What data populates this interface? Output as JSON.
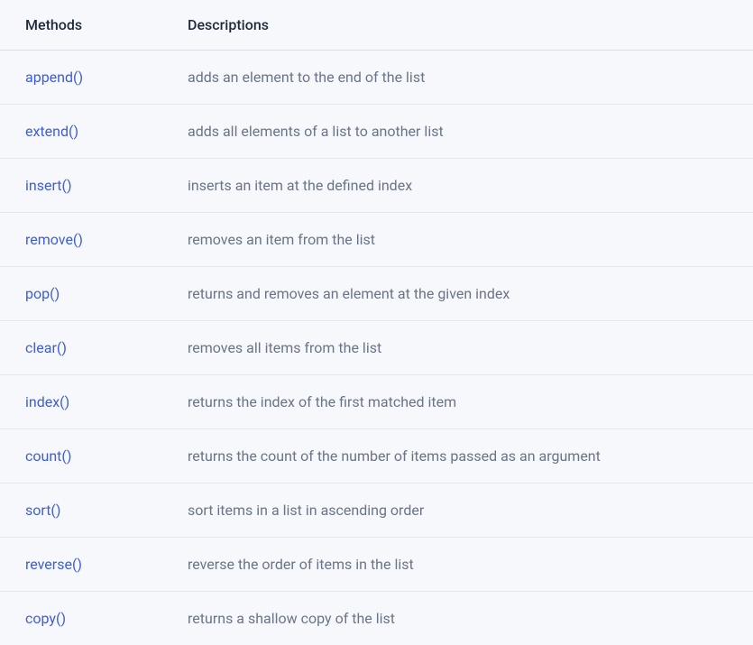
{
  "table": {
    "headers": {
      "methods": "Methods",
      "descriptions": "Descriptions"
    },
    "rows": [
      {
        "method": "append()",
        "description": "adds an element to the end of the list"
      },
      {
        "method": "extend()",
        "description": "adds all elements of a list to another list"
      },
      {
        "method": "insert()",
        "description": "inserts an item at the defined index"
      },
      {
        "method": "remove()",
        "description": "removes an item from the list"
      },
      {
        "method": "pop()",
        "description": "returns and removes an element at the given index"
      },
      {
        "method": "clear()",
        "description": "removes all items from the list"
      },
      {
        "method": "index()",
        "description": "returns the index of the first matched item"
      },
      {
        "method": "count()",
        "description": "returns the count of the number of items passed as an argument"
      },
      {
        "method": "sort()",
        "description": "sort items in a list in ascending order"
      },
      {
        "method": "reverse()",
        "description": "reverse the order of items in the list"
      },
      {
        "method": "copy()",
        "description": "returns a shallow copy of the list"
      }
    ]
  }
}
